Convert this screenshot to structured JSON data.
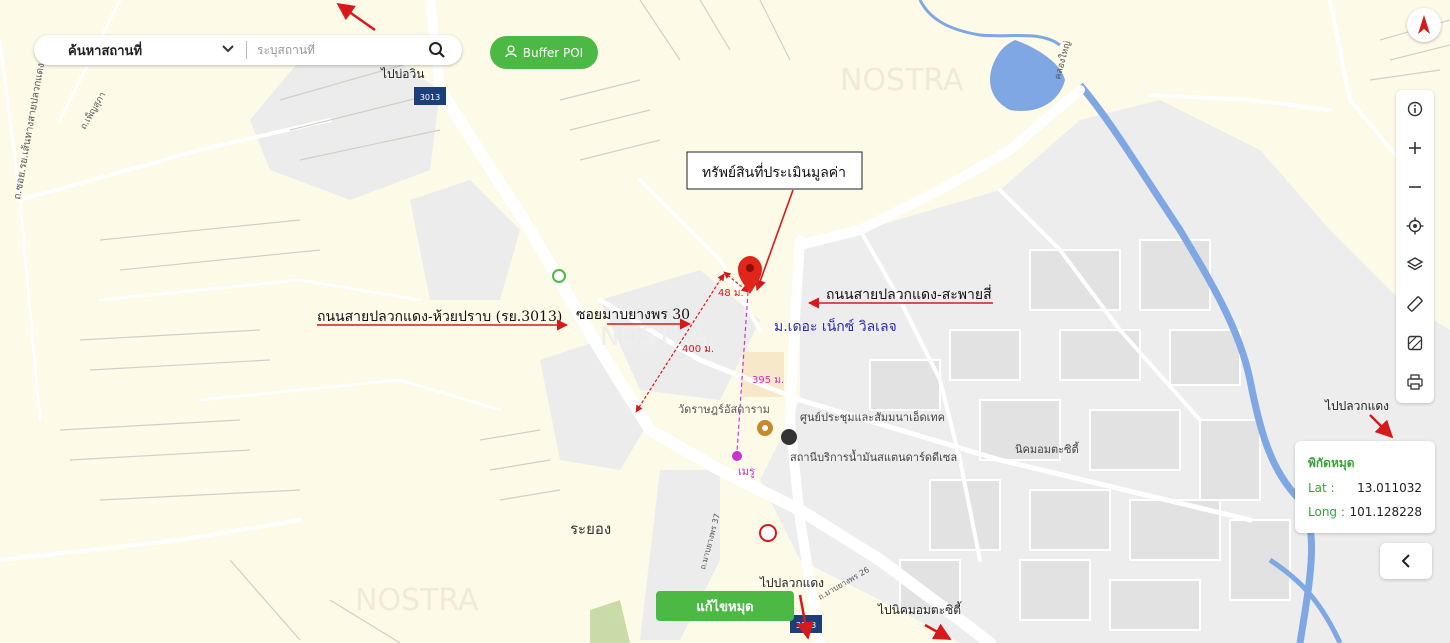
{
  "search": {
    "category": "ค้นหาสถานที่",
    "placeholder": "ระบุสถานที่"
  },
  "buffer_button": "Buffer POI",
  "coordinates": {
    "title": "พิกัดหมุด",
    "lat_label": "Lat :",
    "lat_value": "13.011032",
    "long_label": "Long :",
    "long_value": "101.128228"
  },
  "fix_pin_button": "แก้ไขหมุด",
  "annotations": {
    "subject_property": "ทรัพย์สินที่ประเมินมูลค่า",
    "road_huai_prap": "ถนนสายปลวกแดง-ห้วยปราบ (รย.3013)",
    "soi": "ซอยมาบยางพร 30",
    "road_saphai": "ถนนสายปลวกแดง-สะพายสี่",
    "village": "ม.เดอะ เน็กซ์ วิลเลจ",
    "dist_48": "48 ม.",
    "dist_400": "400 ม.",
    "dist_395": "395 ม."
  },
  "map_labels": {
    "to_bo_win": "ไปบ่อวิน",
    "route_3013_top": "3013",
    "route_3013_bottom": "3013",
    "to_pluak_daeng_right": "ไปปลวกแดง",
    "to_pluak_daeng_bottom": "ไปปลวกแดง",
    "to_amata": "ไปนิคมอมตะซิตี้",
    "rayong": "ระยอง",
    "temple": "วัดราษฎร์อัสดาราม",
    "meru": "เมรู",
    "convention": "ศูนย์ประชุมและสัมมนาเอ็ดเทค",
    "station": "สถานีบริการน้ำมันสแตนดาร์ดดีเซล",
    "amata_city": "นิคมอมตะซิตี้",
    "road_left_vertical": "ถ.ซอย.รย.เส้นทางสายปลวกแดง",
    "road_left_small": "ถ.เพ็ญสุภา",
    "road_khlong": "คลองใหญ่",
    "road_map_yang_37": "ถ.มาบยางพร 37",
    "road_map_yang_26": "ถ.มาบยางพร 26",
    "watermark": "NOSTRA"
  },
  "colors": {
    "accent_green": "#4cb944",
    "annotation_red": "#d7191c",
    "measure_purple": "#cc33cc",
    "water": "#7ea7e3",
    "road": "#ffffff",
    "industrial": "#eeeeee"
  },
  "icons": {
    "search": "search-icon",
    "user": "user-icon",
    "compass": "north-arrow-icon",
    "info": "info-icon",
    "zoom_in": "plus-icon",
    "zoom_out": "minus-icon",
    "locate": "crosshair-icon",
    "layers": "layers-icon",
    "measure": "ruler-icon",
    "area": "area-icon",
    "print": "printer-icon",
    "pin": "map-pin-icon"
  }
}
